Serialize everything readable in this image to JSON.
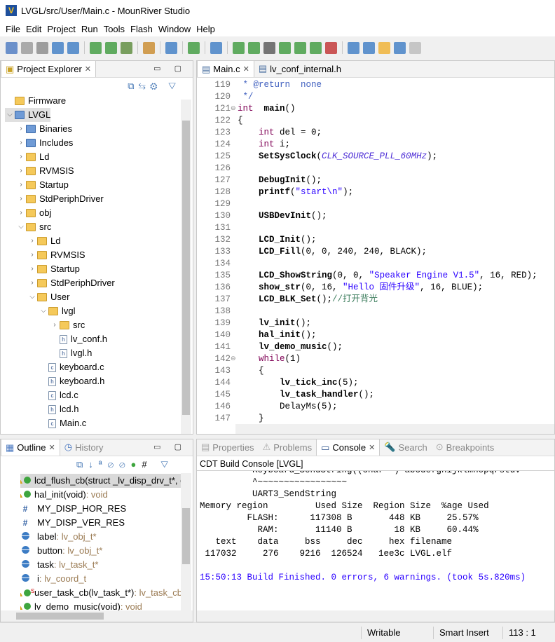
{
  "window": {
    "title": "LVGL/src/User/Main.c - MounRiver Studio"
  },
  "menu": [
    "File",
    "Edit",
    "Project",
    "Run",
    "Tools",
    "Flash",
    "Window",
    "Help"
  ],
  "explorer": {
    "tab": "Project Explorer",
    "items": [
      {
        "level": 0,
        "icon": "folder",
        "label": "Firmware",
        "chev": ""
      },
      {
        "level": 0,
        "icon": "project",
        "label": "LVGL",
        "chev": "v",
        "selected": true
      },
      {
        "level": 1,
        "icon": "binaries",
        "label": "Binaries",
        "chev": ">"
      },
      {
        "level": 1,
        "icon": "includes",
        "label": "Includes",
        "chev": ">"
      },
      {
        "level": 1,
        "icon": "folder",
        "label": "Ld",
        "chev": ">"
      },
      {
        "level": 1,
        "icon": "folder",
        "label": "RVMSIS",
        "chev": ">"
      },
      {
        "level": 1,
        "icon": "folder",
        "label": "Startup",
        "chev": ">"
      },
      {
        "level": 1,
        "icon": "folder",
        "label": "StdPeriphDriver",
        "chev": ">"
      },
      {
        "level": 1,
        "icon": "folder",
        "label": "obj",
        "chev": ">"
      },
      {
        "level": 1,
        "icon": "folder",
        "label": "src",
        "chev": "v"
      },
      {
        "level": 2,
        "icon": "folder",
        "label": "Ld",
        "chev": ">"
      },
      {
        "level": 2,
        "icon": "folder",
        "label": "RVMSIS",
        "chev": ">"
      },
      {
        "level": 2,
        "icon": "folder",
        "label": "Startup",
        "chev": ">"
      },
      {
        "level": 2,
        "icon": "folder",
        "label": "StdPeriphDriver",
        "chev": ">"
      },
      {
        "level": 2,
        "icon": "folder",
        "label": "User",
        "chev": "v"
      },
      {
        "level": 3,
        "icon": "folder",
        "label": "lvgl",
        "chev": "v"
      },
      {
        "level": 4,
        "icon": "folder",
        "label": "src",
        "chev": ">"
      },
      {
        "level": 4,
        "icon": "h-file",
        "label": "lv_conf.h",
        "chev": ""
      },
      {
        "level": 4,
        "icon": "h-file",
        "label": "lvgl.h",
        "chev": ""
      },
      {
        "level": 3,
        "icon": "c-file",
        "label": "keyboard.c",
        "chev": ""
      },
      {
        "level": 3,
        "icon": "h-file",
        "label": "keyboard.h",
        "chev": ""
      },
      {
        "level": 3,
        "icon": "c-file",
        "label": "lcd.c",
        "chev": ""
      },
      {
        "level": 3,
        "icon": "h-file",
        "label": "lcd.h",
        "chev": ""
      },
      {
        "level": 3,
        "icon": "c-file",
        "label": "Main.c",
        "chev": ""
      }
    ]
  },
  "editor": {
    "tabs": [
      "Main.c",
      "lv_conf_internal.h"
    ],
    "lines": [
      {
        "n": "119",
        "s": [
          [
            "cmd",
            " * @return  none"
          ]
        ]
      },
      {
        "n": "120",
        "s": [
          [
            "cmd",
            " */"
          ]
        ]
      },
      {
        "n": "121",
        "fold": true,
        "s": [
          [
            "kw",
            "int"
          ],
          [
            "",
            "  "
          ],
          [
            "fn",
            "main"
          ],
          [
            "",
            "()"
          ]
        ]
      },
      {
        "n": "122",
        "s": [
          [
            "",
            "{"
          ]
        ]
      },
      {
        "n": "123",
        "s": [
          [
            "",
            "    "
          ],
          [
            "kw",
            "int"
          ],
          [
            "",
            " del = 0;"
          ]
        ]
      },
      {
        "n": "124",
        "s": [
          [
            "",
            "    "
          ],
          [
            "kw",
            "int"
          ],
          [
            "",
            " i;"
          ]
        ]
      },
      {
        "n": "125",
        "s": [
          [
            "",
            "    "
          ],
          [
            "fn",
            "SetSysClock"
          ],
          [
            "",
            "("
          ],
          [
            "mac",
            "CLK_SOURCE_PLL_60MHz"
          ],
          [
            "",
            ");"
          ]
        ]
      },
      {
        "n": "126",
        "s": []
      },
      {
        "n": "127",
        "s": [
          [
            "",
            "    "
          ],
          [
            "fn",
            "DebugInit"
          ],
          [
            "",
            "();"
          ]
        ]
      },
      {
        "n": "128",
        "s": [
          [
            "",
            "    "
          ],
          [
            "fn",
            "printf"
          ],
          [
            "",
            "("
          ],
          [
            "str",
            "\"start\\n\""
          ],
          [
            "",
            ");"
          ]
        ]
      },
      {
        "n": "129",
        "s": []
      },
      {
        "n": "130",
        "s": [
          [
            "",
            "    "
          ],
          [
            "fn",
            "USBDevInit"
          ],
          [
            "",
            "();"
          ]
        ]
      },
      {
        "n": "131",
        "s": []
      },
      {
        "n": "132",
        "s": [
          [
            "",
            "    "
          ],
          [
            "fn",
            "LCD_Init"
          ],
          [
            "",
            "();"
          ]
        ]
      },
      {
        "n": "133",
        "s": [
          [
            "",
            "    "
          ],
          [
            "fn",
            "LCD_Fill"
          ],
          [
            "",
            "(0, 0, 240, 240, BLACK);"
          ]
        ]
      },
      {
        "n": "134",
        "s": []
      },
      {
        "n": "135",
        "s": [
          [
            "",
            "    "
          ],
          [
            "fn",
            "LCD_ShowString"
          ],
          [
            "",
            "(0, 0, "
          ],
          [
            "str",
            "\"Speaker Engine V1.5\""
          ],
          [
            "",
            ", 16, RED);"
          ]
        ]
      },
      {
        "n": "136",
        "s": [
          [
            "",
            "    "
          ],
          [
            "fn",
            "show_str"
          ],
          [
            "",
            "(0, 16, "
          ],
          [
            "str",
            "\"Hello 固件升级\""
          ],
          [
            "",
            ", 16, BLUE);"
          ]
        ]
      },
      {
        "n": "137",
        "s": [
          [
            "",
            "    "
          ],
          [
            "fn",
            "LCD_BLK_Set"
          ],
          [
            "",
            "();"
          ],
          [
            "cm",
            "//打开背光"
          ]
        ]
      },
      {
        "n": "138",
        "s": []
      },
      {
        "n": "139",
        "s": [
          [
            "",
            "    "
          ],
          [
            "fn",
            "lv_init"
          ],
          [
            "",
            "();"
          ]
        ]
      },
      {
        "n": "140",
        "s": [
          [
            "",
            "    "
          ],
          [
            "fn",
            "hal_init"
          ],
          [
            "",
            "();"
          ]
        ]
      },
      {
        "n": "141",
        "s": [
          [
            "",
            "    "
          ],
          [
            "fn",
            "lv_demo_music"
          ],
          [
            "",
            "();"
          ]
        ]
      },
      {
        "n": "142",
        "fold": true,
        "s": [
          [
            "",
            "    "
          ],
          [
            "kw",
            "while"
          ],
          [
            "",
            "(1)"
          ]
        ]
      },
      {
        "n": "143",
        "s": [
          [
            "",
            "    {"
          ]
        ]
      },
      {
        "n": "144",
        "s": [
          [
            "",
            "        "
          ],
          [
            "fn",
            "lv_tick_inc"
          ],
          [
            "",
            "(5);"
          ]
        ]
      },
      {
        "n": "145",
        "s": [
          [
            "",
            "        "
          ],
          [
            "fn",
            "lv_task_handler"
          ],
          [
            "",
            "();"
          ]
        ]
      },
      {
        "n": "146",
        "s": [
          [
            "",
            "        "
          ],
          [
            "",
            "DelayMs(5);"
          ]
        ]
      },
      {
        "n": "147",
        "s": [
          [
            "",
            "    }"
          ]
        ]
      }
    ]
  },
  "outline": {
    "tabs": [
      "Outline",
      "History"
    ],
    "items": [
      {
        "icon": "warn-method",
        "name": "lcd_flush_cb(struct _lv_disp_drv_t*, c",
        "type": "",
        "selected": true
      },
      {
        "icon": "warn-method",
        "name": "hal_init(void)",
        "type": " : void"
      },
      {
        "icon": "macro",
        "name": "MY_DISP_HOR_RES",
        "type": ""
      },
      {
        "icon": "macro",
        "name": "MY_DISP_VER_RES",
        "type": ""
      },
      {
        "icon": "variable",
        "name": "label",
        "type": " : lv_obj_t*"
      },
      {
        "icon": "variable",
        "name": "button",
        "type": " : lv_obj_t*"
      },
      {
        "icon": "variable",
        "name": "task",
        "type": " : lv_task_t*"
      },
      {
        "icon": "variable",
        "name": "i",
        "type": " : lv_coord_t"
      },
      {
        "icon": "warn-static-method",
        "name": "user_task_cb(lv_task_t*)",
        "type": " : lv_task_cb"
      },
      {
        "icon": "warn-method",
        "name": "lv_demo_music(void)",
        "type": " : void"
      }
    ]
  },
  "bottom_tabs": [
    "Properties",
    "Problems",
    "Console",
    "Search",
    "Breakpoints"
  ],
  "console": {
    "title": "CDT Build Console [LVGL]",
    "lines": [
      "          Keyboard_SendString((char *)\"abcdefghijklmnopqrstuv",
      "          ^~~~~~~~~~~~~~~~~~",
      "          UART3_SendString",
      "Memory region         Used Size  Region Size  %age Used",
      "         FLASH:      117308 B       448 KB     25.57%",
      "           RAM:       11140 B        18 KB     60.44%",
      "   text    data     bss     dec     hex filename",
      " 117032     276    9216  126524   1ee3c LVGL.elf",
      "",
      "15:50:13 Build Finished. 0 errors, 6 warnings. (took 5s.820ms)"
    ],
    "finished_color": "#2a00ff"
  },
  "status": {
    "writable": "Writable",
    "insert_mode": "Smart Insert",
    "position": "113 : 1"
  }
}
